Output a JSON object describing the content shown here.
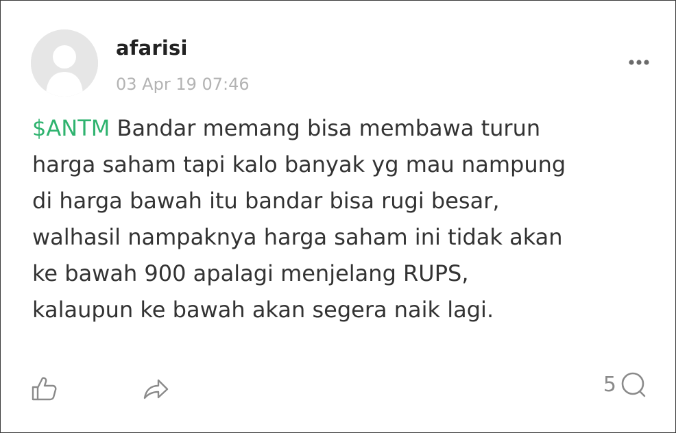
{
  "post": {
    "author": "afarisi",
    "timestamp": "03 Apr 19 07:46",
    "ticker": "$ANTM",
    "text_lines": [
      " Bandar memang bisa membawa turun",
      "harga saham tapi kalo banyak yg mau nampung",
      "di harga bawah itu bandar bisa rugi besar,",
      "walhasil nampaknya harga saham ini tidak akan",
      "ke bawah 900 apalagi menjelang RUPS,",
      "kalaupun ke bawah akan segera naik lagi."
    ]
  },
  "actions": {
    "comment_count": "5"
  },
  "icons": {
    "avatar": "default-user-avatar",
    "more": "more-horizontal-icon",
    "like": "thumbs-up-icon",
    "share": "share-arrow-icon",
    "comment": "comment-bubble-icon"
  },
  "colors": {
    "ticker": "#2fb36f",
    "text": "#333333",
    "muted": "#b3b3b3",
    "icon": "#8a8a8a"
  }
}
